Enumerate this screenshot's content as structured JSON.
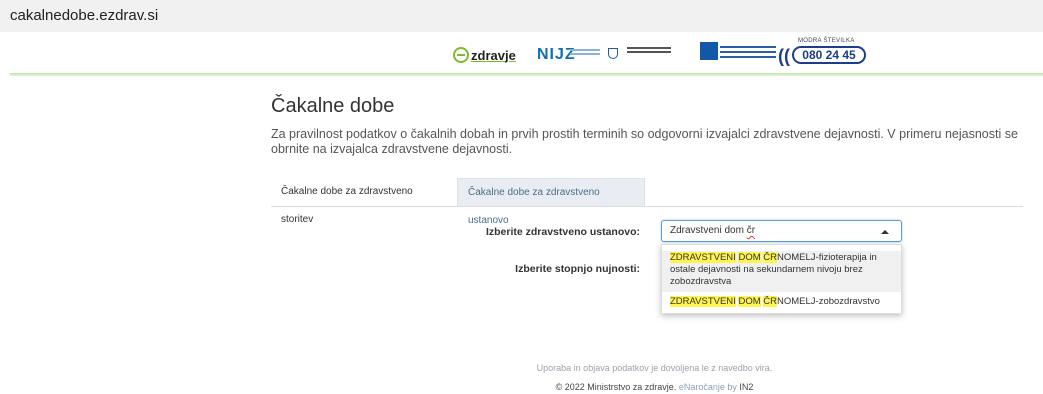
{
  "browser": {
    "url": "cakalnedobe.ezdrav.si"
  },
  "header": {
    "logos": {
      "zdravje": "zdravje",
      "nijz": "NIJZ",
      "modra_label": "MODRA ŠTEVILKA",
      "modra_number": "080 24 45"
    }
  },
  "page": {
    "title": "Čakalne dobe",
    "intro": "Za pravilnost podatkov o čakalnih dobah in prvih prostih terminih so odgovorni izvajalci zdravstvene dejavnosti. V primeru nejasnosti se obrnite na izvajalca zdravstvene dejavnosti.",
    "tabs": [
      {
        "label": "Čakalne dobe za zdravstveno storitev",
        "active": false
      },
      {
        "label": "Čakalne dobe za zdravstveno ustanovo",
        "active": true
      }
    ],
    "form": {
      "ustanova_label": "Izberite zdravstveno ustanovo:",
      "nujnost_label": "Izberite stopnjo nujnosti:",
      "search_prefix": "Zdravstveni dom ",
      "search_typo": "čr",
      "options": [
        {
          "hl1": "ZDRAVSTVENI",
          "hl2": "DOM",
          "hl3": "ČR",
          "rest": "NOMELJ-fizioterapija in ostale dejavnosti na sekundarnem nivoju brez zobozdravstva"
        },
        {
          "hl1": "ZDRAVSTVENI",
          "hl2": "DOM",
          "hl3": "ČR",
          "rest": "NOMELJ-zobozdravstvo"
        }
      ]
    }
  },
  "footer": {
    "line1": "Uporaba in objava podatkov je dovoljena le z navedbo vira.",
    "copyright": "© 2022 Ministrstvo za zdravje.",
    "enarocanje": "eNaročanje by",
    "in2": "IN2"
  }
}
